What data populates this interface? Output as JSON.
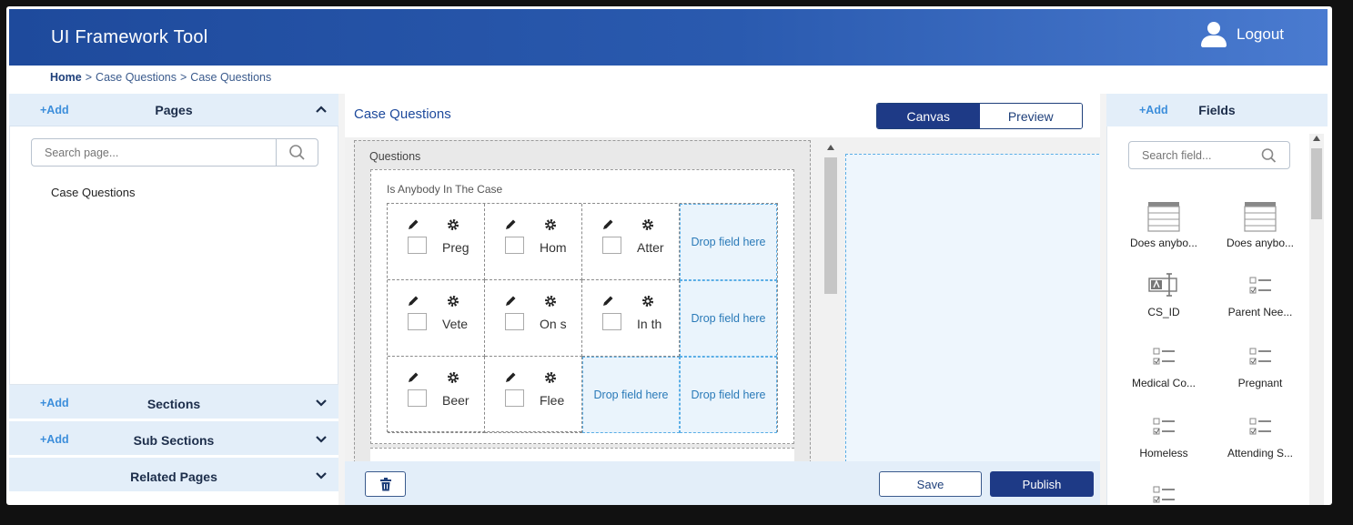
{
  "header": {
    "app_title": "UI Framework Tool",
    "logout_label": "Logout"
  },
  "breadcrumb": {
    "home": "Home",
    "sep": ">",
    "crumb1": "Case Questions",
    "crumb2": "Case Questions"
  },
  "left": {
    "add_label": "+Add",
    "pages_title": "Pages",
    "search_placeholder": "Search page...",
    "page_items": [
      "Case Questions"
    ],
    "sections_title": "Sections",
    "sub_sections_title": "Sub Sections",
    "related_pages_title": "Related Pages"
  },
  "center": {
    "title": "Case Questions",
    "canvas_label": "Canvas",
    "preview_label": "Preview",
    "questions_label": "Questions",
    "section_label": "Is Anybody In The Case",
    "drop_label": "Drop field here",
    "cells": [
      [
        "Preg",
        "Hom",
        "Atter"
      ],
      [
        "Vete",
        "On s",
        "In th"
      ],
      [
        "Beer",
        "Flee"
      ]
    ],
    "save_label": "Save",
    "publish_label": "Publish"
  },
  "right": {
    "add_label": "+Add",
    "fields_title": "Fields",
    "search_placeholder": "Search field...",
    "fields": [
      {
        "name": "Does anybo...",
        "icon": "table-icon"
      },
      {
        "name": "Does anybo...",
        "icon": "table-icon"
      },
      {
        "name": "CS_ID",
        "icon": "text-field-icon"
      },
      {
        "name": "Parent Nee...",
        "icon": "checklist-icon"
      },
      {
        "name": "Medical Co...",
        "icon": "checklist-icon"
      },
      {
        "name": "Pregnant",
        "icon": "checklist-icon"
      },
      {
        "name": "Homeless",
        "icon": "checklist-icon"
      },
      {
        "name": "Attending S...",
        "icon": "checklist-icon"
      }
    ]
  },
  "colors": {
    "header_start": "#1e4a9c",
    "header_end": "#4a7bd0",
    "accent": "#1e3a86",
    "link": "#3c8edb",
    "drop_border": "#5aaee6"
  }
}
